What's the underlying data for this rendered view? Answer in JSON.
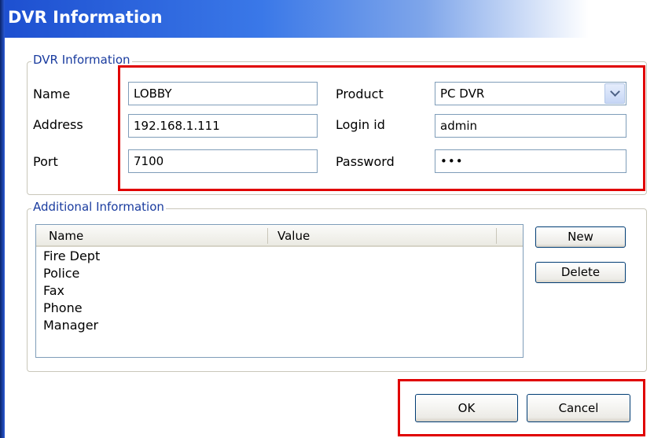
{
  "window": {
    "title": "DVR Information"
  },
  "dvr_group": {
    "legend": "DVR Information",
    "name_label": "Name",
    "name_value": "LOBBY",
    "address_label": "Address",
    "address_value": "192.168.1.111",
    "port_label": "Port",
    "port_value": "7100",
    "product_label": "Product",
    "product_value": "PC DVR",
    "login_label": "Login id",
    "login_value": "admin",
    "password_label": "Password",
    "password_value": "•••"
  },
  "additional_group": {
    "legend": "Additional Information",
    "columns": [
      "Name",
      "Value"
    ],
    "rows": [
      "Fire Dept",
      "Police",
      "Fax",
      "Phone",
      "Manager"
    ],
    "new_label": "New",
    "delete_label": "Delete"
  },
  "footer": {
    "ok_label": "OK",
    "cancel_label": "Cancel"
  },
  "colors": {
    "highlight": "#e00000",
    "title_blue": "#1d4fd0"
  }
}
